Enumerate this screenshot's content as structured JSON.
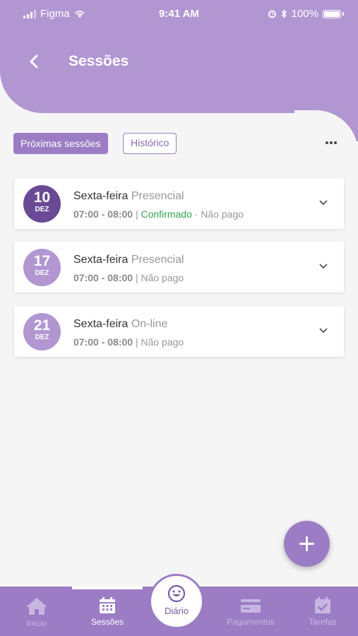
{
  "status_bar": {
    "carrier": "Figma",
    "time": "9:41 AM",
    "battery": "100%"
  },
  "header": {
    "title": "Sessões"
  },
  "tabs": [
    {
      "label": "Próximas sessões",
      "active": true
    },
    {
      "label": "Histórico",
      "active": false
    }
  ],
  "sessions": [
    {
      "day": "10",
      "month": "DEZ",
      "weekday": "Sexta-feira",
      "mode": "Presencial",
      "time": "07:00 - 08:00",
      "status": "Confirmado",
      "payment": "Não pago"
    },
    {
      "day": "17",
      "month": "DEZ",
      "weekday": "Sexta-feira",
      "mode": "Presencial",
      "time": "07:00 - 08:00",
      "payment": "Não pago"
    },
    {
      "day": "21",
      "month": "DEZ",
      "weekday": "Sexta-feira",
      "mode": "On-line",
      "time": "07:00 - 08:00",
      "payment": "Não pago"
    }
  ],
  "nav": {
    "inicio": "Início",
    "sessoes": "Sessões",
    "diario": "Diário",
    "pagamentos": "Pagamentos",
    "tarefas": "Tarefas"
  },
  "colors": {
    "accent": "#9b7cc5",
    "header": "#b196d2",
    "dark_date": "#6a4a95",
    "confirmed": "#2fa84f"
  }
}
